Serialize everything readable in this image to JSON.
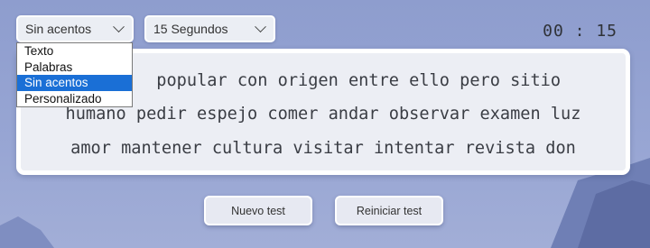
{
  "settings": {
    "mode_value": "Sin acentos",
    "mode_options": [
      "Texto",
      "Palabras",
      "Sin acentos",
      "Personalizado"
    ],
    "mode_selected_index": 2,
    "time_value": "15 Segundos"
  },
  "timer": {
    "display": "00 : 15"
  },
  "text": {
    "line1": "pública popular con origen entre ello pero sitio",
    "line1_visible": "popular con origen entre ello pero sitio",
    "line2": "humano pedir espejo comer andar observar examen luz",
    "line3": "amor mantener cultura visitar intentar revista don"
  },
  "buttons": {
    "new_test": "Nuevo test",
    "restart_test": "Reiniciar test"
  },
  "colors": {
    "background": "#97a5d3",
    "panel": "#eceef4",
    "selected_option": "#1a6fd6"
  }
}
